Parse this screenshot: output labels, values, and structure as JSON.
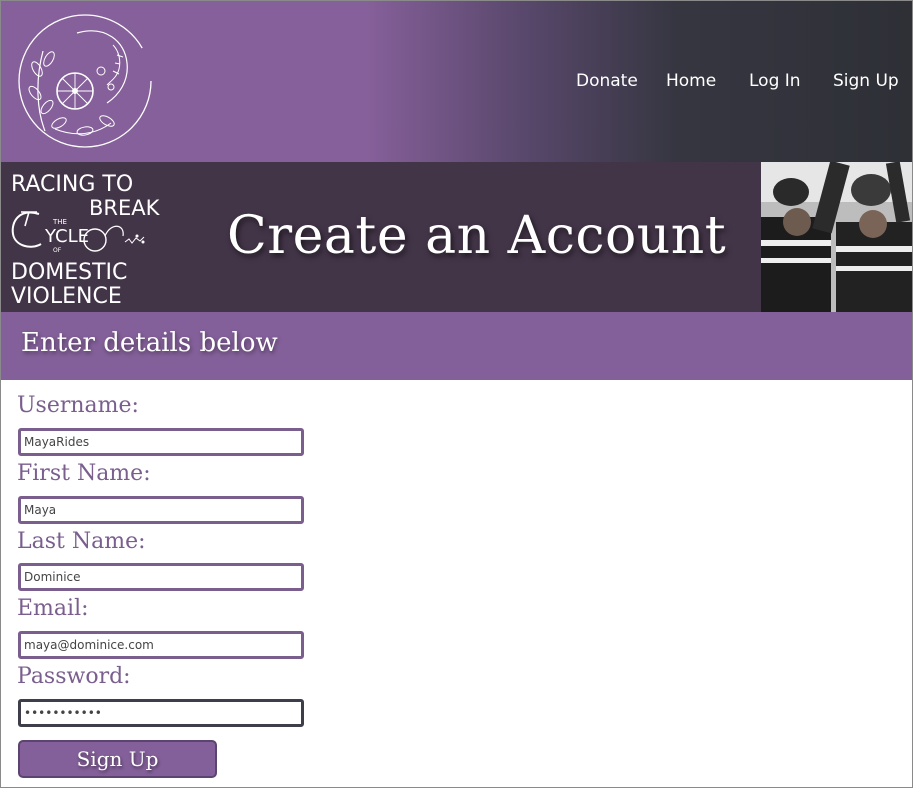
{
  "nav": {
    "donate": "Donate",
    "home": "Home",
    "login": "Log In",
    "signup": "Sign Up"
  },
  "banner": {
    "logo_line1": "RACING TO",
    "logo_line2": "BREAK",
    "logo_the": "THE",
    "logo_cycle": "YCLE",
    "logo_of": "OF",
    "logo_line4": "DOMESTIC",
    "logo_line5": "VIOLENCE",
    "title": "Create an Account"
  },
  "subheader": "Enter details below",
  "form": {
    "username_label": "Username:",
    "username_value": "MayaRides",
    "firstname_label": "First Name:",
    "firstname_value": "Maya",
    "lastname_label": "Last Name:",
    "lastname_value": "Dominice",
    "email_label": "Email:",
    "email_value": "maya@dominice.com",
    "password_label": "Password:",
    "password_value": "•••••••••••",
    "submit_label": "Sign Up"
  },
  "colors": {
    "brand_purple": "#84609a",
    "dark_nav": "#2e3036",
    "banner_bg": "#433548",
    "label_text": "#7a5e8e"
  },
  "icons": {
    "header_logo": "woman-face-bicycle-wheel-logo",
    "banner_photo": "cyclists-team-photo"
  }
}
